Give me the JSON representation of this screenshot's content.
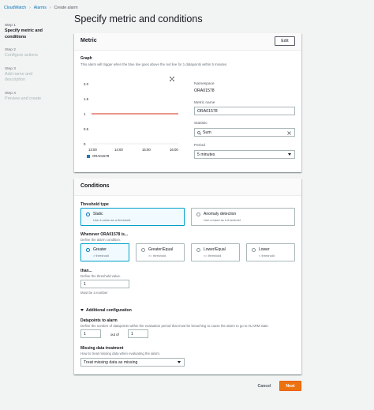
{
  "breadcrumb": {
    "items": [
      "CloudWatch",
      "Alarms",
      "Create alarm"
    ],
    "separator": "›"
  },
  "page_title": "Specify metric and conditions",
  "steps": [
    {
      "num": "Step 1",
      "label_lines": [
        "Specify metric and",
        "conditions"
      ]
    },
    {
      "num": "Step 2",
      "label_lines": [
        "Configure actions"
      ]
    },
    {
      "num": "Step 3",
      "label_lines": [
        "Add name and",
        "description"
      ]
    },
    {
      "num": "Step 4",
      "label_lines": [
        "Preview and create"
      ]
    }
  ],
  "metric": {
    "header": "Metric",
    "edit_label": "Edit",
    "graph_label": "Graph",
    "graph_desc": "This alarm will trigger when the blue line goes above the red line for 1 datapoints within 5 minutes.",
    "namespace_label": "Namespace",
    "namespace_value": "ORA01578",
    "metric_name_label": "Metric name",
    "metric_name_value": "ORA01578",
    "statistic_label": "Statistic",
    "statistic_value": "Sum",
    "period_label": "Period",
    "period_value": "5 minutes"
  },
  "chart_data": {
    "type": "line",
    "title": "",
    "x": [
      "13:00",
      "14:00",
      "15:00",
      "16:00"
    ],
    "ylim": [
      0,
      2.0
    ],
    "yticks": [
      "2.0",
      "1.5",
      "1",
      "0.5",
      "0"
    ],
    "series": [
      {
        "name": "ORA01578",
        "values": []
      }
    ],
    "threshold": {
      "value": 1,
      "color": "#d13212"
    },
    "series_color": "#1f77b4",
    "legend": "bottom-left"
  },
  "conditions": {
    "header": "Conditions",
    "threshold_type_label": "Threshold type",
    "static_title": "Static",
    "static_desc": "Use a value as a threshold",
    "anomaly_title": "Anomaly detection",
    "anomaly_desc": "Use a band as a threshold",
    "whenever_label": "Whenever ORA01578 is...",
    "whenever_desc": "Define the alarm condition.",
    "operators": [
      {
        "title": "Greater",
        "desc": "> threshold"
      },
      {
        "title": "Greater/Equal",
        "desc": ">= threshold"
      },
      {
        "title": "Lower/Equal",
        "desc": "<= threshold"
      },
      {
        "title": "Lower",
        "desc": "< threshold"
      }
    ],
    "than_label": "than...",
    "than_desc": "Define the threshold value.",
    "than_value": "1",
    "than_hint": "Must be a number",
    "additional_label": "Additional configuration",
    "datapoints_label": "Datapoints to alarm",
    "datapoints_desc": "Define the number of datapoints within the evaluation period that must be breaching to cause the alarm to go to ALARM state.",
    "datapoints_value": "1",
    "out_of_label": "out of",
    "evaluation_value": "1",
    "missing_label": "Missing data treatment",
    "missing_desc": "How to treat missing data when evaluating the alarm.",
    "missing_value": "Treat missing data as missing"
  },
  "footer": {
    "cancel_label": "Cancel",
    "next_label": "Next"
  }
}
